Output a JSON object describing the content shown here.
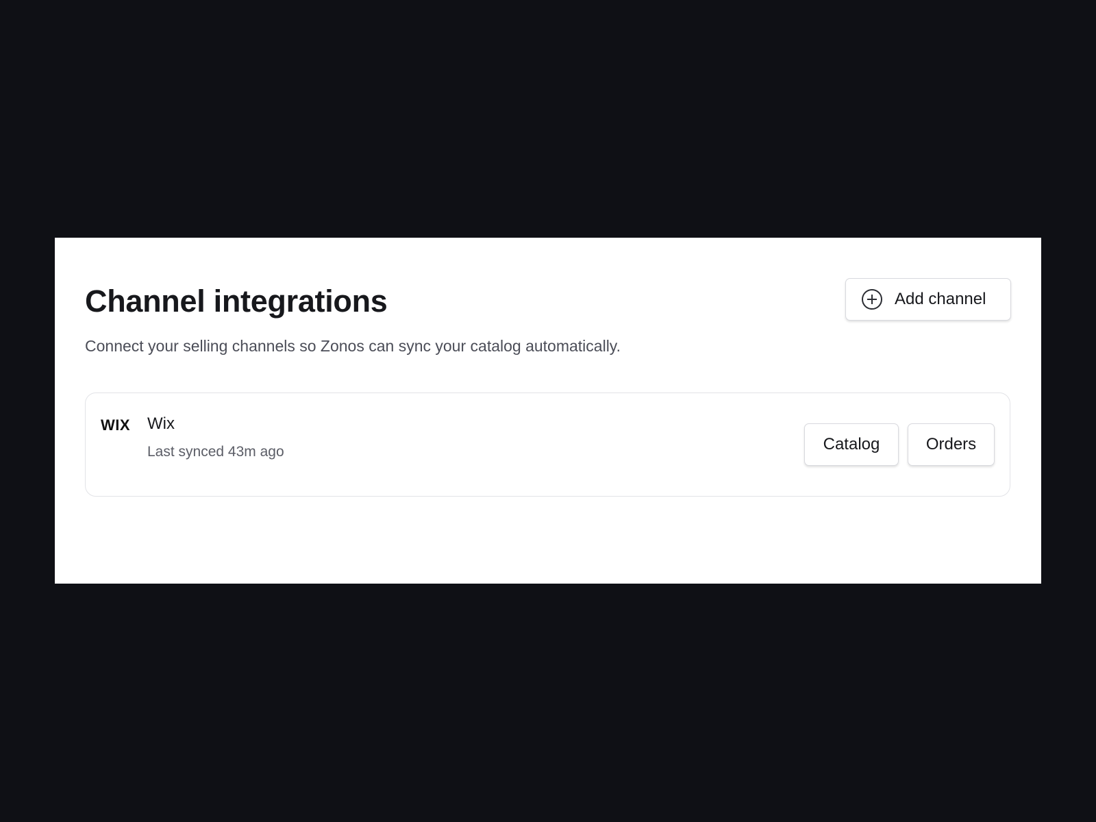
{
  "header": {
    "title": "Channel integrations",
    "subtitle": "Connect your selling channels so Zonos can sync your catalog automatically.",
    "add_channel_label": "Add channel",
    "add_channel_icon": "plus-circle-icon"
  },
  "channels": [
    {
      "logo_text": "WIX",
      "name": "Wix",
      "status": "Last synced 43m ago",
      "actions": [
        "Catalog",
        "Orders"
      ]
    }
  ],
  "colors": {
    "background": "#0f1015",
    "panel": "#ffffff",
    "text_primary": "#17181c",
    "text_secondary": "#4b4d57",
    "border": "#d8d9de"
  }
}
